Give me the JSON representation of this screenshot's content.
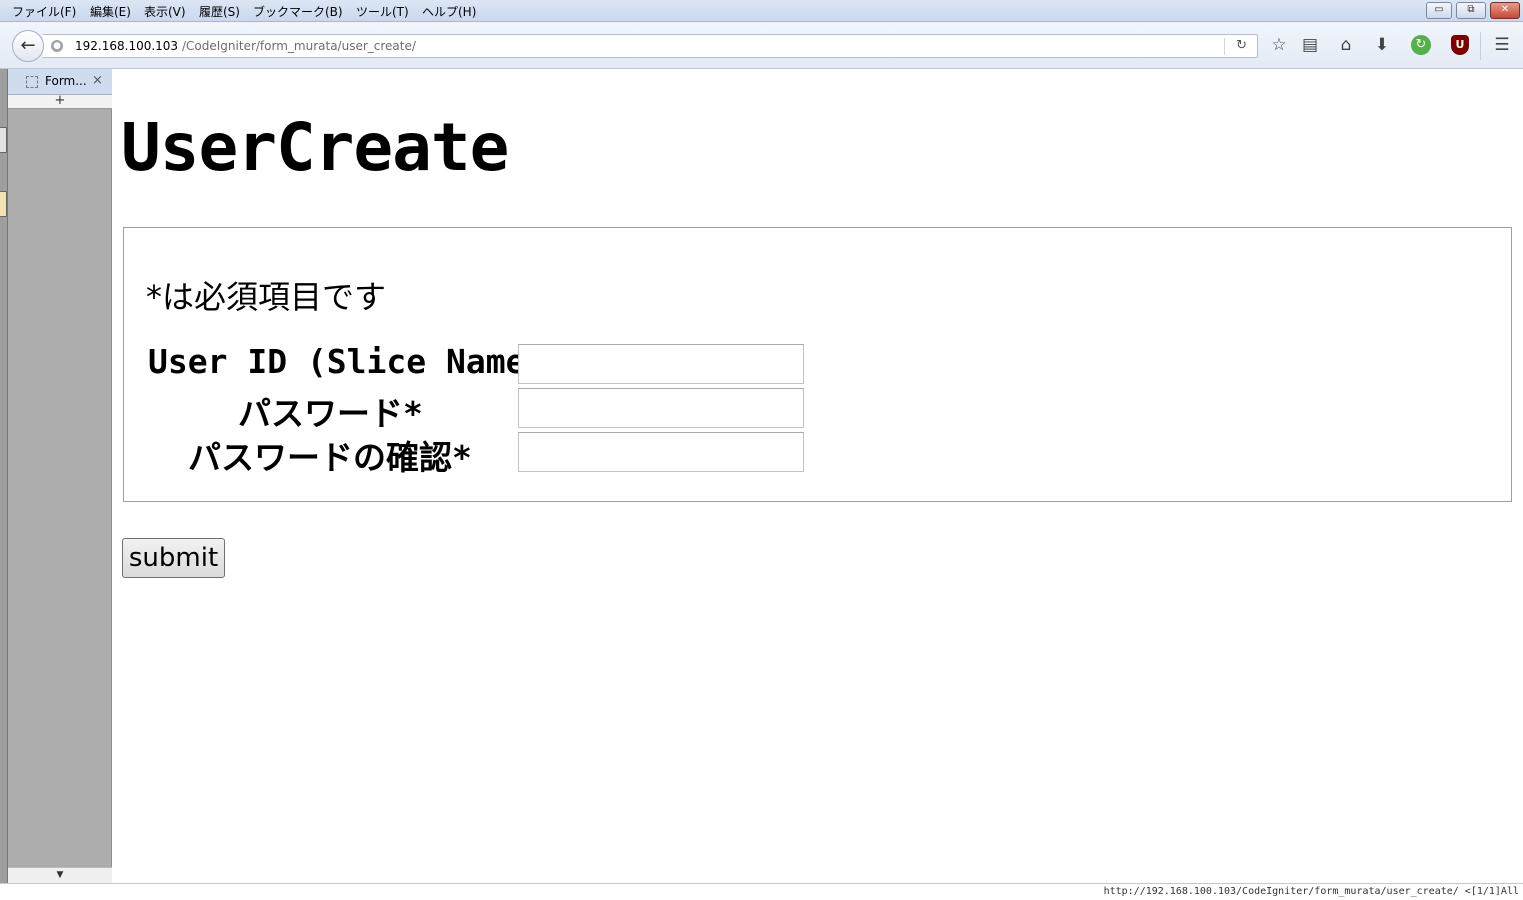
{
  "menu": {
    "items": [
      "ファイル(F)",
      "編集(E)",
      "表示(V)",
      "履歴(S)",
      "ブックマーク(B)",
      "ツール(T)",
      "ヘルプ(H)"
    ]
  },
  "window_controls": {
    "minimize": "▭",
    "restore": "⧉",
    "close": "✕"
  },
  "nav": {
    "url_host": "192.168.100.103",
    "url_path": "/CodeIgniter/form_murata/user_create/",
    "icons": [
      "star-icon",
      "reading-list-icon",
      "home-icon",
      "download-icon",
      "sync-icon",
      "ublock-icon",
      "hamburger-menu-icon"
    ]
  },
  "tabs": [
    {
      "title": "Form...",
      "close": "×"
    }
  ],
  "sidebar": {
    "new_tab": "+"
  },
  "page": {
    "title": "UserCreate",
    "required_note": "*は必須項目です",
    "fields": [
      {
        "label": "User ID (Slice Name)*",
        "value": ""
      },
      {
        "label": "パスワード*",
        "value": ""
      },
      {
        "label": "パスワードの確認*",
        "value": ""
      }
    ],
    "submit_label": "submit"
  },
  "status": {
    "text": "http://192.168.100.103/CodeIgniter/form_murata/user_create/ <[1/1]All"
  },
  "colors": {
    "menubar": "#c9d8ee",
    "sidebar": "#adadad",
    "active_tab": "#cfdcf0",
    "sync_green": "#53b148",
    "ublock_red": "#800000"
  }
}
